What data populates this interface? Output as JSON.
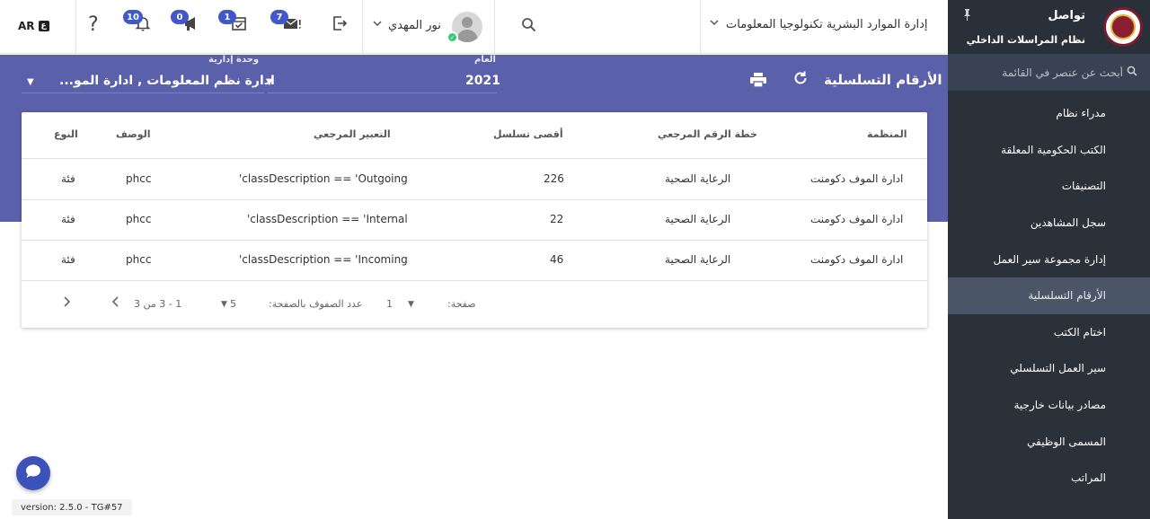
{
  "sidebar": {
    "app_title": "تواصل",
    "app_subtitle": "نظام المراسلات الداخلي",
    "search_placeholder": "أبحث عن عنصر في القائمة",
    "items": [
      {
        "label": "مدراء نظام"
      },
      {
        "label": "الكتب الحكومية المعلقة"
      },
      {
        "label": "التصنيفات"
      },
      {
        "label": "سجل المشاهدين"
      },
      {
        "label": "إدارة مجموعة سير العمل"
      },
      {
        "label": "الأرقام التسلسلية"
      },
      {
        "label": "اختام الكتب"
      },
      {
        "label": "سير العمل التسلسلي"
      },
      {
        "label": "مصادر بيانات خارجية"
      },
      {
        "label": "المسمى الوظيفي"
      },
      {
        "label": "المراتب"
      }
    ],
    "active_index": 5
  },
  "header": {
    "organization": "إدارة الموارد البشرية تكنولوجيا المعلومات",
    "user_name": "نور المهدي",
    "badges": {
      "mail": "7",
      "tasks": "1",
      "announcements": "0",
      "notifications": "10"
    },
    "language": "AR"
  },
  "page": {
    "title": "الأرقام التسلسلية",
    "year_label": "العام",
    "year_value": "2021",
    "unit_label": "وحدة إدارية",
    "unit_value": "ادارة نظم المعلومات , ادارة المو..."
  },
  "table": {
    "headers": {
      "org": "المنظمة",
      "plan": "خطة الرقم المرجعي",
      "max": "أقصى تسلسل",
      "expr": "التعبير المرجعي",
      "desc": "الوصف",
      "type": "النوع"
    },
    "rows": [
      {
        "org": "ادارة الموف دكومنت",
        "plan": "الرعاية الصحية",
        "max": "226",
        "expr": "'classDescription == 'Outgoing",
        "desc": "phcc",
        "type": "فئة"
      },
      {
        "org": "ادارة الموف دكومنت",
        "plan": "الرعاية الصحية",
        "max": "22",
        "expr": "'classDescription == 'Internal",
        "desc": "phcc",
        "type": "فئة"
      },
      {
        "org": "ادارة الموف دكومنت",
        "plan": "الرعاية الصحية",
        "max": "46",
        "expr": "'classDescription == 'Incoming",
        "desc": "phcc",
        "type": "فئة"
      }
    ]
  },
  "pagination": {
    "page_label": "صفحة:",
    "page_value": "1",
    "rows_label": "عدد الصفوف بالصفحة:",
    "rows_value": "5",
    "range": "1 - 3 من 3"
  },
  "footer": {
    "version": "version: 2.5.0 - TG#57"
  },
  "colors": {
    "banner": "#5b60aa",
    "sidebar": "#2b3139",
    "badge": "#4058c9"
  }
}
